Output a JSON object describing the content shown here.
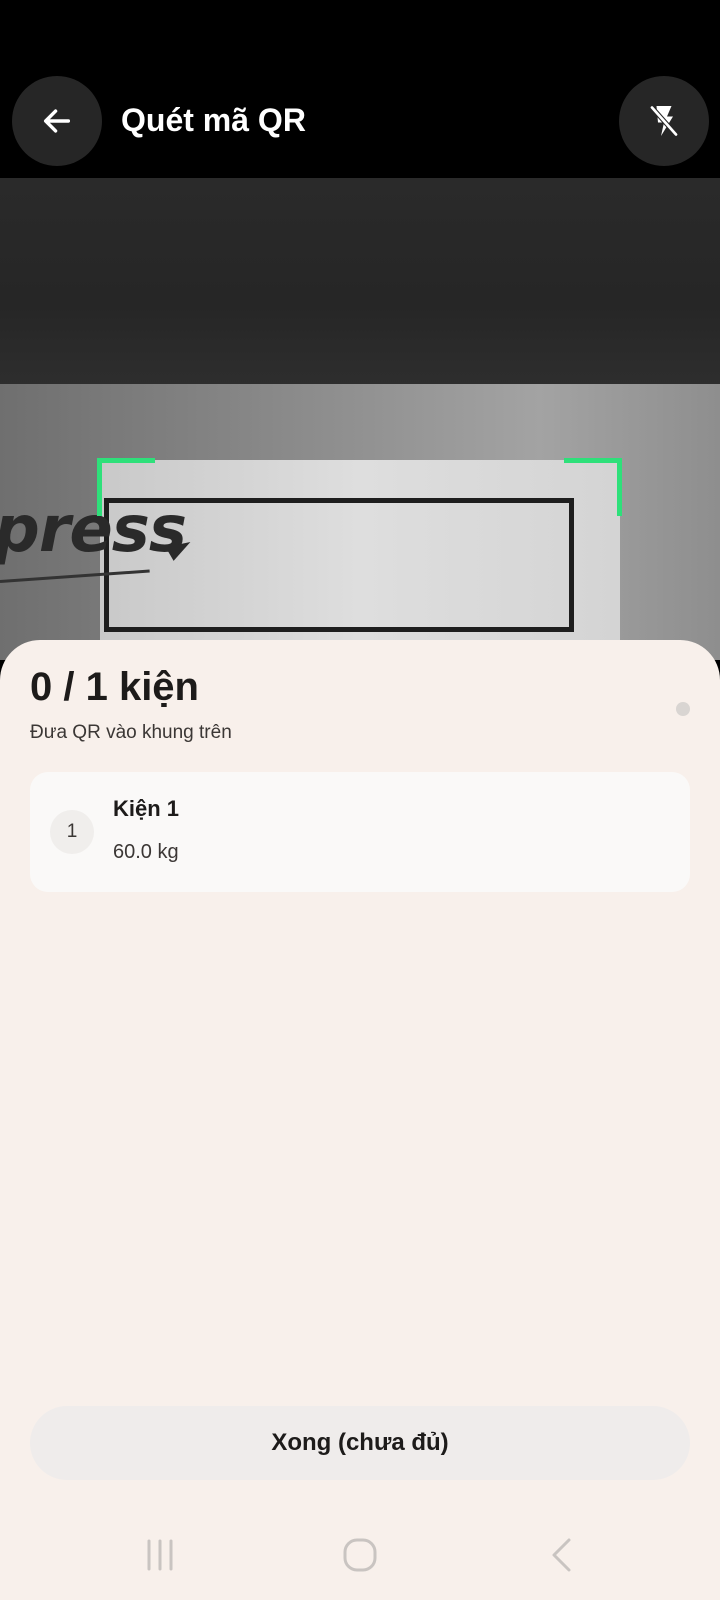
{
  "header": {
    "title": "Quét mã QR",
    "back_icon": "arrow-left-icon",
    "flash_icon": "flash-off-icon"
  },
  "camera": {
    "visible_label_text": "press"
  },
  "sheet": {
    "count_text": "0 / 1 kiện",
    "hint_text": "Đưa QR vào khung trên",
    "packages": [
      {
        "index": "1",
        "name": "Kiện 1",
        "weight": "60.0 kg"
      }
    ],
    "done_button_label": "Xong (chưa đủ)"
  },
  "system_nav": {
    "recent_icon": "recent-apps-icon",
    "home_icon": "home-icon",
    "back_icon": "nav-back-icon"
  },
  "colors": {
    "scan_frame": "#2ee07a",
    "sheet_background": "#f8f0eb",
    "button_background": "#efeceb",
    "topbar_button": "#262626"
  }
}
